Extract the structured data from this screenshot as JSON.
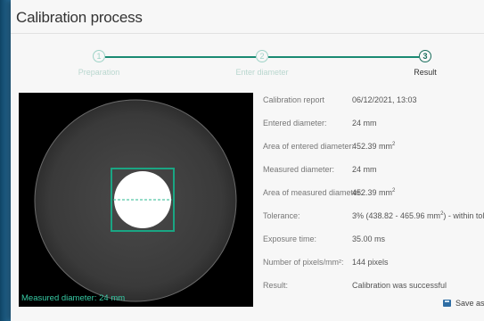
{
  "page": {
    "title": "Calibration process"
  },
  "stepper": {
    "steps": [
      {
        "number": "1",
        "label": "Preparation",
        "state": "done"
      },
      {
        "number": "2",
        "label": "Enter diameter",
        "state": "done"
      },
      {
        "number": "3",
        "label": "Result",
        "state": "active"
      }
    ]
  },
  "camera": {
    "measured_label": "Measured diameter: 24 mm"
  },
  "report": {
    "rows": [
      {
        "label": "Calibration report",
        "value": "06/12/2021, 13:03"
      },
      {
        "label": "Entered diameter:",
        "value": "24 mm"
      },
      {
        "label": "Area of entered diameter:",
        "value": "452.39 mm",
        "sup": "2"
      },
      {
        "label": "Measured diameter:",
        "value": "24 mm"
      },
      {
        "label": "Area of measured diameter:",
        "value": "452.39 mm",
        "sup": "2"
      },
      {
        "label": "Tolerance:",
        "value_pre": "3% (438.82 - 465.96 mm",
        "sup": "2",
        "value_post": ") - within tolerance"
      },
      {
        "label": "Exposure time:",
        "value": "35.00 ms"
      },
      {
        "label": "Number of pixels/mm²:",
        "value": "144 pixels"
      },
      {
        "label": "Result:",
        "value": "Calibration was successful"
      }
    ]
  },
  "actions": {
    "save_label": "Save as Pr"
  },
  "colors": {
    "accent": "#1a8a73",
    "frame": "#1f5f85",
    "measure_text": "#36c9a3"
  }
}
